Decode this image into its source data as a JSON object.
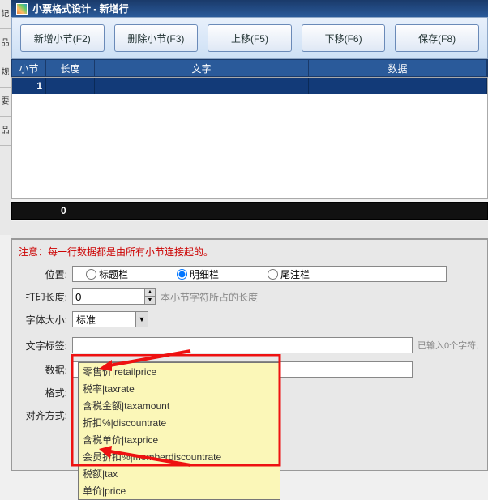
{
  "window": {
    "title": "小票格式设计 - 新增行"
  },
  "leftnav": [
    "记",
    "品",
    "规",
    "要",
    "品"
  ],
  "toolbar": {
    "new_btn": "新增小节(F2)",
    "del_btn": "删除小节(F3)",
    "up_btn": "上移(F5)",
    "down_btn": "下移(F6)",
    "save_btn": "保存(F8)"
  },
  "grid": {
    "cols": {
      "sn": "小节",
      "len": "长度",
      "text": "文字",
      "data": "数据"
    },
    "rows": [
      {
        "sn": "1",
        "len": "",
        "text": "",
        "data": ""
      }
    ],
    "footer_zero": "0"
  },
  "notice": "注意：每一行数据都是由所有小节连接起的。",
  "form": {
    "position_lbl": "位置:",
    "radio_title": "标题栏",
    "radio_detail": "明细栏",
    "radio_footer": "尾注栏",
    "printlen_lbl": "打印长度:",
    "printlen_val": "0",
    "printlen_hint": "本小节字符所占的长度",
    "fontsize_lbl": "字体大小:",
    "fontsize_val": "标准",
    "label_lbl": "文字标签:",
    "label_val": "",
    "charcount": "已输入0个字符,",
    "data_lbl": "数据:",
    "format_lbl": "格式:",
    "align_lbl": "对齐方式:"
  },
  "dropdown": [
    "零售价|retailprice",
    "税率|taxrate",
    "含税金额|taxamount",
    "折扣%|discountrate",
    "含税单价|taxprice",
    "会员折扣%|memberdiscountrate",
    "税额|tax",
    "单价|price"
  ]
}
